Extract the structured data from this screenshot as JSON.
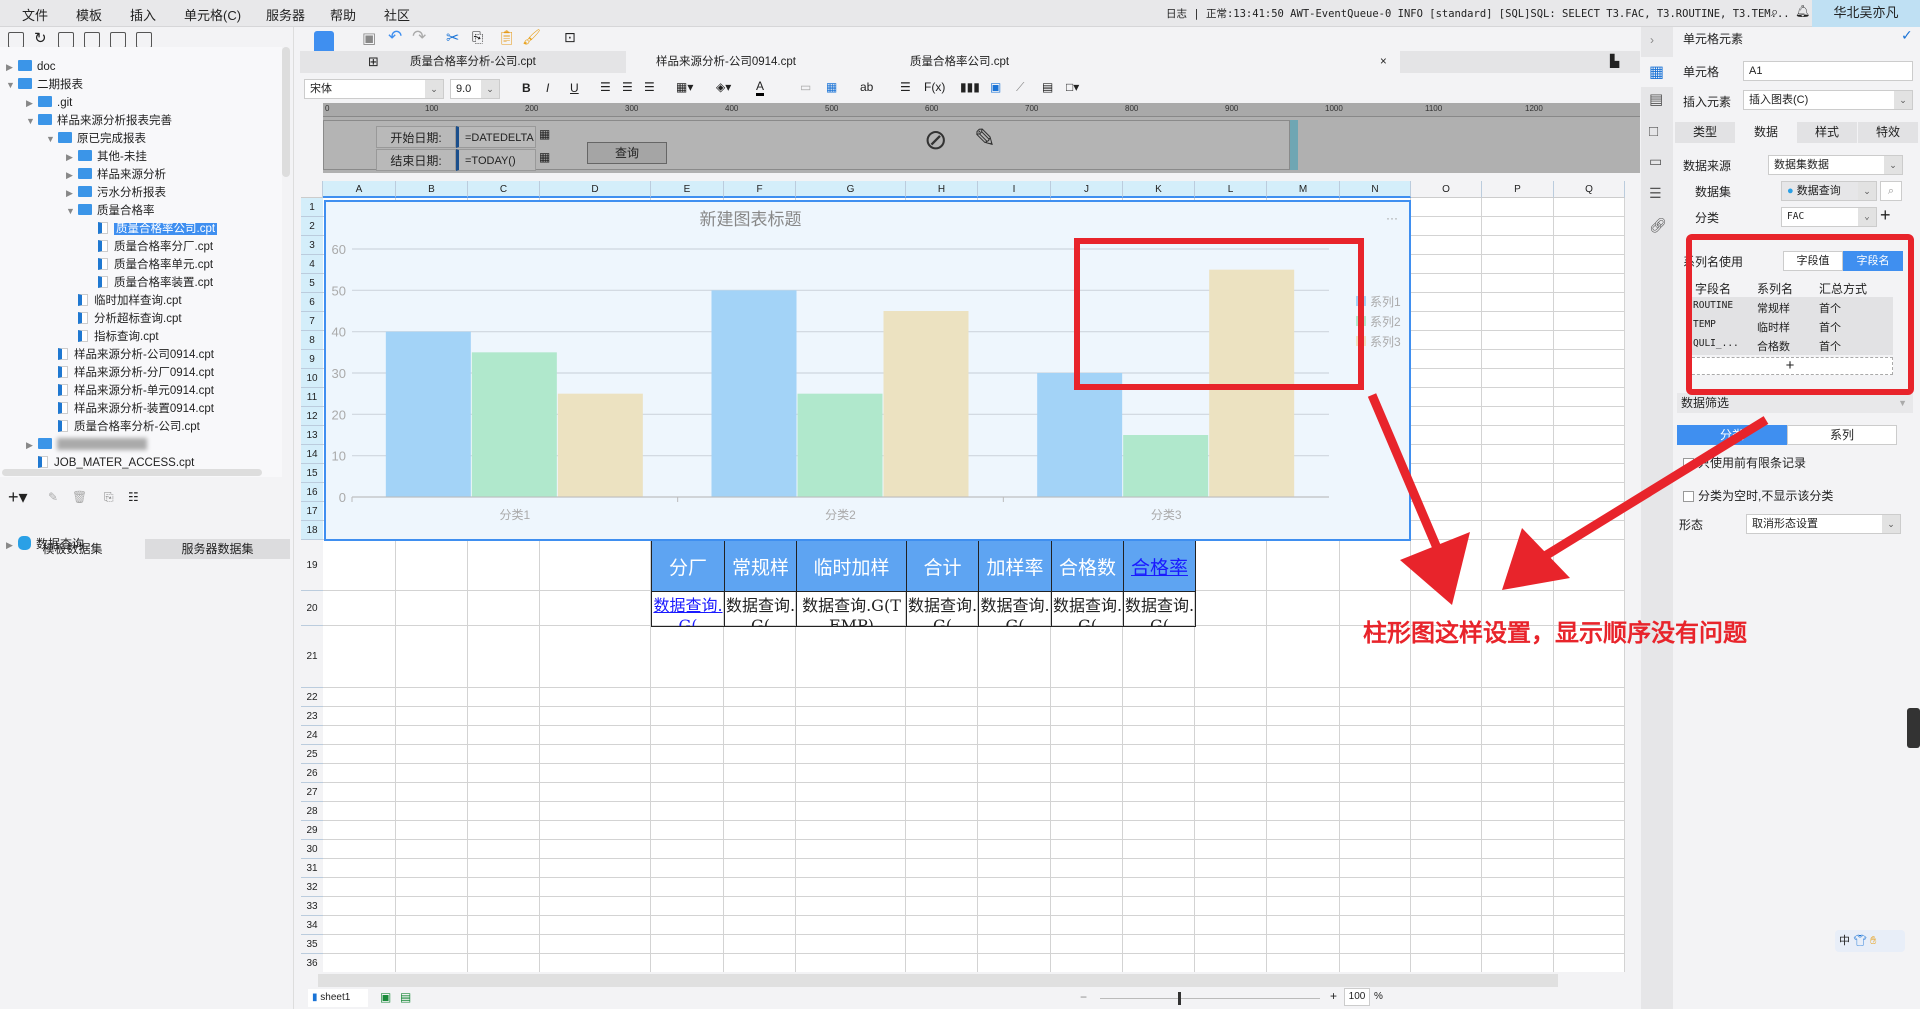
{
  "menubar": {
    "items": [
      "文件",
      "模板",
      "插入",
      "单元格(C)",
      "服务器",
      "帮助",
      "社区"
    ],
    "log_label": "日志",
    "status_text": "正常:13:41:50 AWT-EventQueue-0 INFO [standard] [SQL]SQL: SELECT T3.FAC, T3.ROUTINE, T3.TEM...",
    "user": "华北吴亦凡"
  },
  "tree": {
    "items": [
      {
        "label": "doc",
        "type": "folder",
        "level": 0,
        "toggle": "▶"
      },
      {
        "label": "二期报表",
        "type": "folder",
        "level": 0,
        "toggle": "▼"
      },
      {
        "label": ".git",
        "type": "folder",
        "level": 1,
        "toggle": "▶"
      },
      {
        "label": "样品来源分析报表完善",
        "type": "folder",
        "level": 1,
        "toggle": "▼"
      },
      {
        "label": "原已完成报表",
        "type": "folder",
        "level": 2,
        "toggle": "▼"
      },
      {
        "label": "其他-未挂",
        "type": "folder",
        "level": 3,
        "toggle": "▶"
      },
      {
        "label": "样品来源分析",
        "type": "folder",
        "level": 3,
        "toggle": "▶"
      },
      {
        "label": "污水分析报表",
        "type": "folder",
        "level": 3,
        "toggle": "▶"
      },
      {
        "label": "质量合格率",
        "type": "folder",
        "level": 3,
        "toggle": "▼"
      },
      {
        "label": "质量合格率公司.cpt",
        "type": "file",
        "level": 4,
        "selected": true
      },
      {
        "label": "质量合格率分厂.cpt",
        "type": "file",
        "level": 4
      },
      {
        "label": "质量合格率单元.cpt",
        "type": "file",
        "level": 4
      },
      {
        "label": "质量合格率装置.cpt",
        "type": "file",
        "level": 4
      },
      {
        "label": "临时加样查询.cpt",
        "type": "file",
        "level": 3
      },
      {
        "label": "分析超标查询.cpt",
        "type": "file",
        "level": 3
      },
      {
        "label": "指标查询.cpt",
        "type": "file",
        "level": 3
      },
      {
        "label": "样品来源分析-公司0914.cpt",
        "type": "file",
        "level": 2
      },
      {
        "label": "样品来源分析-分厂0914.cpt",
        "type": "file",
        "level": 2
      },
      {
        "label": "样品来源分析-单元0914.cpt",
        "type": "file",
        "level": 2
      },
      {
        "label": "样品来源分析-装置0914.cpt",
        "type": "file",
        "level": 2
      },
      {
        "label": "质量合格率分析-公司.cpt",
        "type": "file",
        "level": 2
      },
      {
        "label": "",
        "type": "folder",
        "level": 1,
        "toggle": "▶",
        "blurred": true
      },
      {
        "label": "JOB_MATER_ACCESS.cpt",
        "type": "file",
        "level": 1
      }
    ]
  },
  "dataset_panel": {
    "tabs": [
      "模板数据集",
      "服务器数据集"
    ],
    "items": [
      "数据查询"
    ]
  },
  "editor_tabs": [
    "质量合格率分析-公司.cpt",
    "样品来源分析-公司0914.cpt",
    "质量合格率公司.cpt"
  ],
  "format": {
    "font": "宋体",
    "size": "9.0"
  },
  "ruler_ticks": [
    "0",
    "100",
    "200",
    "300",
    "400",
    "500",
    "600",
    "700",
    "800",
    "900",
    "1000",
    "1100",
    "1200"
  ],
  "params": {
    "start_label": "开始日期:",
    "start_value": "=DATEDELTA",
    "end_label": "结束日期:",
    "end_value": "=TODAY()",
    "query_button": "查询"
  },
  "columns": [
    "A",
    "B",
    "C",
    "D",
    "E",
    "F",
    "G",
    "H",
    "I",
    "J",
    "K",
    "L",
    "M",
    "N",
    "O",
    "P",
    "Q"
  ],
  "rows": [
    "1",
    "2",
    "3",
    "4",
    "5",
    "6",
    "7",
    "8",
    "9",
    "10",
    "11",
    "12",
    "13",
    "14",
    "15",
    "16",
    "17",
    "18",
    "19",
    "20",
    "21",
    "22",
    "23",
    "24",
    "25",
    "26",
    "27",
    "28",
    "29",
    "30",
    "31",
    "32",
    "33",
    "34",
    "35",
    "36"
  ],
  "table": {
    "headers": [
      "分厂",
      "常规样",
      "临时加样",
      "合计",
      "加样率",
      "合格数",
      "合格率"
    ],
    "values": [
      "数据查询.G(",
      "数据查询.G(",
      "数据查询.G(TEMP)",
      "数据查询.G(",
      "数据查询.G(",
      "数据查询.G(",
      "数据查询.G("
    ]
  },
  "chart_data": {
    "type": "bar",
    "title": "新建图表标题",
    "categories": [
      "分类1",
      "分类2",
      "分类3"
    ],
    "series": [
      {
        "name": "系列1",
        "values": [
          40,
          50,
          30
        ],
        "color": "#a3d3f7"
      },
      {
        "name": "系列2",
        "values": [
          35,
          25,
          15
        ],
        "color": "#b0e8cc"
      },
      {
        "name": "系列3",
        "values": [
          25,
          45,
          55
        ],
        "color": "#ece2c1"
      }
    ],
    "yticks": [
      "0",
      "10",
      "20",
      "30",
      "40",
      "50",
      "60"
    ],
    "ylim": [
      0,
      60
    ],
    "legend": "right",
    "grid": true,
    "more_label": "···"
  },
  "right_panel": {
    "title": "单元格元素",
    "cell_label": "单元格",
    "cell_value": "A1",
    "insert_label": "插入元素",
    "insert_value": "插入图表(C)",
    "tabs": [
      "类型",
      "数据",
      "样式",
      "特效"
    ],
    "source_label": "数据来源",
    "source_value": "数据集数据",
    "dataset_label": "数据集",
    "dataset_value": "数据查询",
    "category_label": "分类",
    "category_value": "FAC",
    "series_name_label": "系列名使用",
    "series_toggle": [
      "字段值",
      "字段名"
    ],
    "series_headers": [
      "字段名",
      "系列名",
      "汇总方式"
    ],
    "series_rows": [
      [
        "ROUTINE",
        "常规样",
        "首个"
      ],
      [
        "TEMP",
        "临时样",
        "首个"
      ],
      [
        "QULI_...",
        "合格数",
        "首个"
      ]
    ],
    "add": "+",
    "filter_label": "数据筛选",
    "filter_tabs": [
      "分类",
      "系列"
    ],
    "check1": "只使用前有限条记录",
    "check2": "分类为空时,不显示该分类",
    "shape_label": "形态",
    "shape_value": "取消形态设置"
  },
  "bottom": {
    "sheet": "sheet1",
    "zoom": "100",
    "percent": "%"
  },
  "annotation": "柱形图这样设置，显示顺序没有问题",
  "ime": {
    "lang": "中"
  },
  "colors": {
    "accent": "#3f8ff0",
    "header_blue": "#5ea4f2",
    "annotation_red": "#e8242b"
  }
}
